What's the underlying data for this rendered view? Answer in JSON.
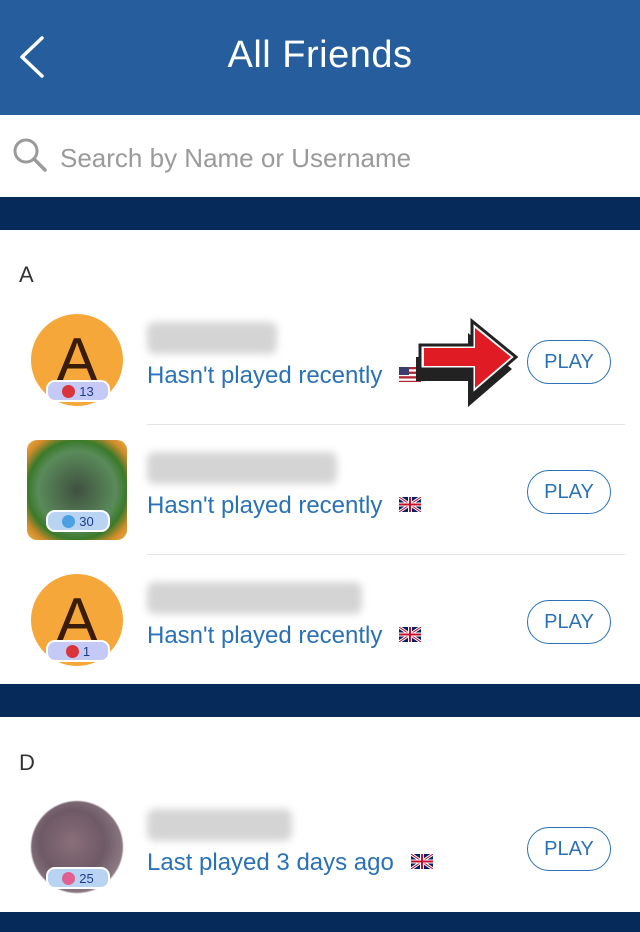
{
  "header": {
    "title": "All Friends",
    "back_icon": "chevron-left-icon"
  },
  "search": {
    "placeholder": "Search by Name or Username",
    "icon": "search-icon"
  },
  "sections": [
    {
      "letter": "A",
      "friends": [
        {
          "avatar_letter": "A",
          "badge_count": "13",
          "status": "Hasn't played recently",
          "flag": "us-flag-icon",
          "play_label": "PLAY"
        },
        {
          "avatar_letter": "",
          "badge_count": "30",
          "status": "Hasn't played recently",
          "flag": "uk-flag-icon",
          "play_label": "PLAY"
        },
        {
          "avatar_letter": "A",
          "badge_count": "1",
          "status": "Hasn't played recently",
          "flag": "uk-flag-icon",
          "play_label": "PLAY"
        }
      ]
    },
    {
      "letter": "D",
      "friends": [
        {
          "avatar_letter": "",
          "badge_count": "25",
          "status": "Last played 3 days ago",
          "flag": "uk-flag-icon",
          "play_label": "PLAY"
        }
      ]
    }
  ],
  "colors": {
    "header": "#255d9d",
    "separator": "#062a5a",
    "accent": "#2a72b7",
    "avatar_orange": "#f6a73a",
    "arrow_red": "#e01b24"
  }
}
